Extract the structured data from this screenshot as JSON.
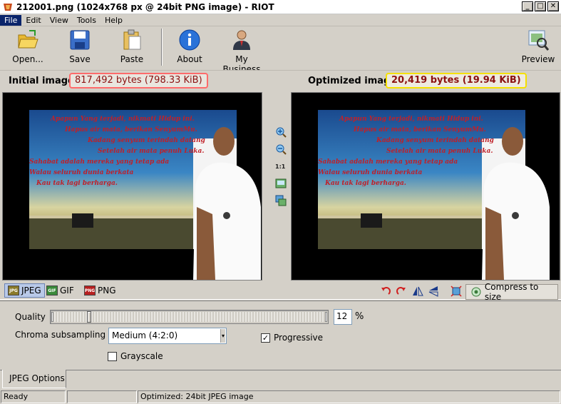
{
  "window": {
    "title": "212001.png (1024x768 px @ 24bit PNG image) - RIOT"
  },
  "menu": [
    "File",
    "Edit",
    "View",
    "Tools",
    "Help"
  ],
  "toolbar": {
    "open": "Open...",
    "save": "Save",
    "paste": "Paste",
    "about": "About",
    "business": "My Business",
    "preview": "Preview"
  },
  "info": {
    "initial_label": "Initial image",
    "initial_size": "817,492 bytes (798.33 KiB)",
    "optimized_label": "Optimized image",
    "optimized_size": "20,419 bytes (19.94 KiB)"
  },
  "image_text": {
    "lines": [
      "Apapun Yang terjadi, nikmati Hidup ini.",
      "Hapus air mata, berikan SenyumMu.",
      "Kadang senyum terindah datang",
      "Setelah air mata penuh Luka.",
      "Sahabat adalah mereka yang tetap ada",
      "Walau seluruh dunia berkata",
      "Kau tak lagi berharga."
    ]
  },
  "side_tools": {
    "zoom_actual": "1:1"
  },
  "formats": {
    "jpeg": "JPEG",
    "gif": "GIF",
    "png": "PNG",
    "compress": "Compress to size"
  },
  "options": {
    "quality_label": "Quality",
    "quality_value": "12",
    "quality_max": "100",
    "percent": "%",
    "chroma_label": "Chroma subsampling",
    "chroma_value": "Medium (4:2:0)",
    "progressive_label": "Progressive",
    "progressive_checked": true,
    "grayscale_label": "Grayscale",
    "grayscale_checked": false,
    "tab_label": "JPEG Options"
  },
  "status": {
    "left": "Ready",
    "middle": "",
    "right": "Optimized: 24bit JPEG image"
  },
  "colors": {
    "initial_border": "#ff6b6b",
    "optimized_border": "#f5e000",
    "selected_menu": "#0a246a",
    "size_text": "#8b1010"
  }
}
